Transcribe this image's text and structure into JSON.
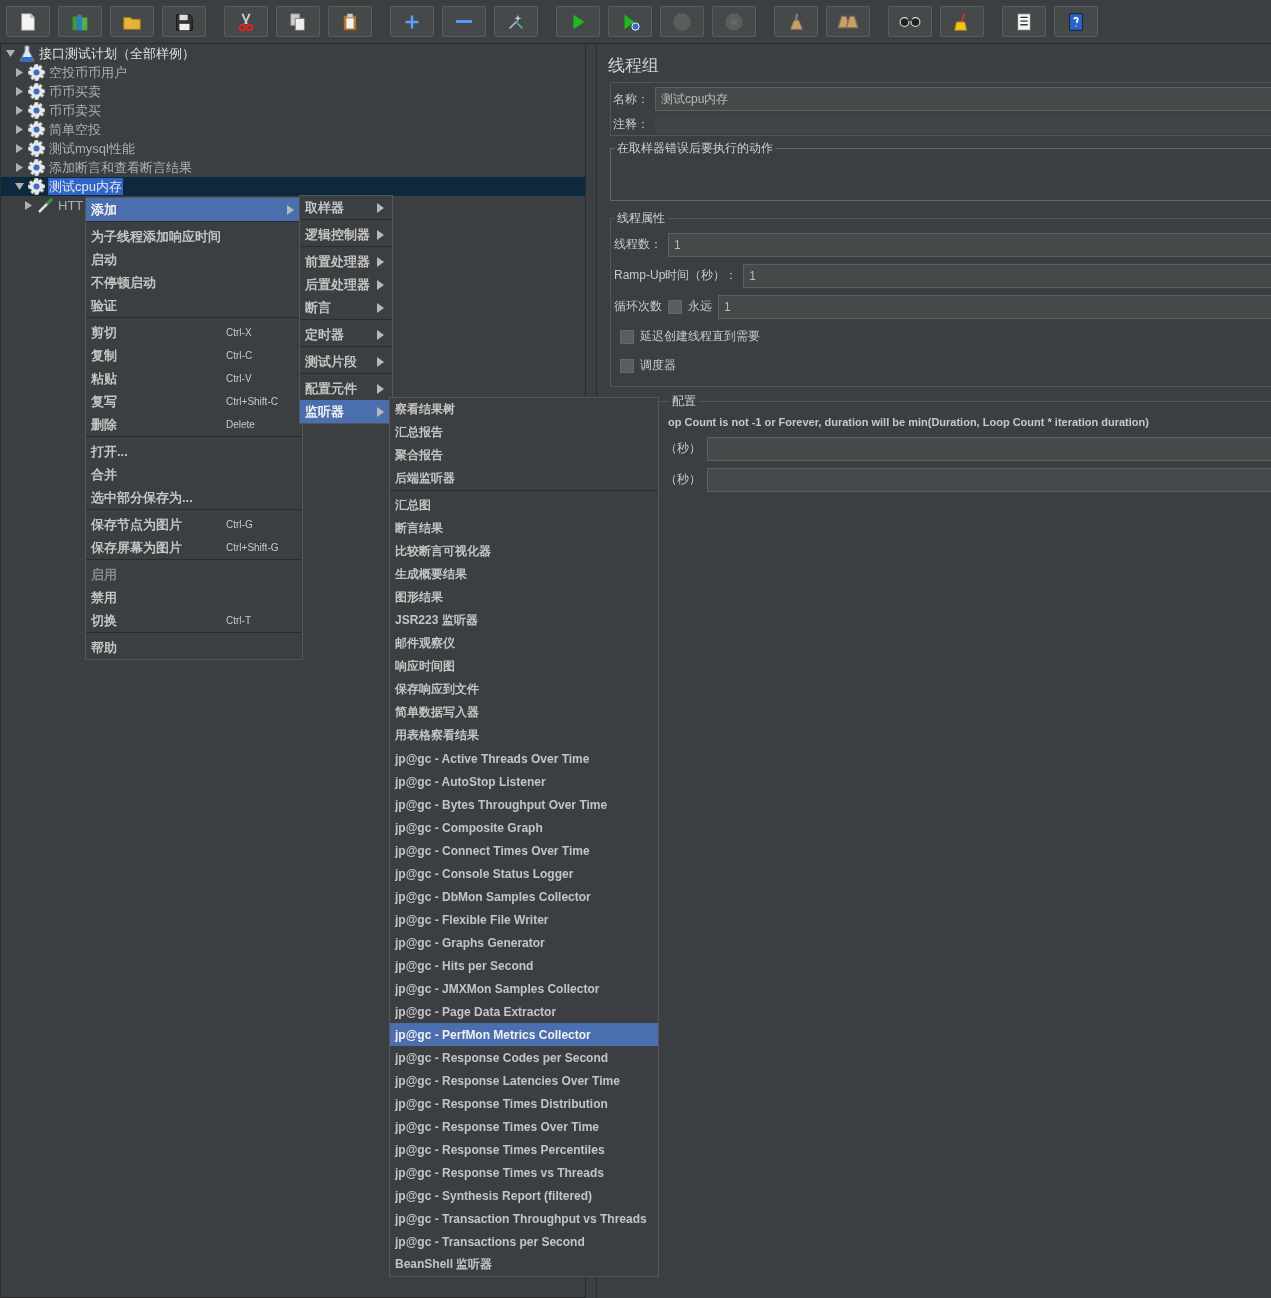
{
  "toolbar": [
    {
      "disabled": false
    },
    {
      "disabled": false
    },
    {
      "disabled": false
    },
    {
      "disabled": false
    },
    {
      "disabled": false
    },
    {
      "disabled": false
    },
    {
      "disabled": false
    },
    {
      "disabled": false
    },
    {
      "disabled": false
    },
    {
      "disabled": false
    },
    {
      "disabled": false
    },
    {
      "disabled": false
    },
    {
      "disabled": true
    },
    {
      "disabled": true
    },
    {
      "disabled": false
    },
    {
      "disabled": false
    },
    {
      "disabled": false
    },
    {
      "disabled": false
    },
    {
      "disabled": false
    },
    {
      "disabled": false
    }
  ],
  "tree": {
    "label": "接口测试计划（全部样例）",
    "kind": "plan",
    "expanded": true,
    "selected": false,
    "children": [
      {
        "label": "空投币币用户",
        "kind": "thread_group",
        "expanded": false,
        "selected": false
      },
      {
        "label": "币币买卖",
        "kind": "thread_group",
        "expanded": false,
        "selected": false
      },
      {
        "label": "币币卖买",
        "kind": "thread_group",
        "expanded": false,
        "selected": false
      },
      {
        "label": "简单空投",
        "kind": "thread_group",
        "expanded": false,
        "selected": false
      },
      {
        "label": "测试mysql性能",
        "kind": "thread_group",
        "expanded": false,
        "selected": false
      },
      {
        "label": "添加断言和查看断言结果",
        "kind": "thread_group",
        "expanded": false,
        "selected": false
      },
      {
        "label": "测试cpu内存",
        "kind": "thread_group",
        "expanded": true,
        "selected": true,
        "children": [
          {
            "label": "HTT",
            "kind": "sampler",
            "expanded": false,
            "selected": false
          }
        ]
      }
    ]
  },
  "context_menu": [
    {
      "kind": "item",
      "label": "添加",
      "submenu": true,
      "selected": true,
      "disabled": false
    },
    {
      "kind": "separator"
    },
    {
      "kind": "item",
      "label": "为子线程添加响应时间",
      "submenu": false,
      "selected": false,
      "disabled": false
    },
    {
      "kind": "item",
      "label": "启动",
      "submenu": false,
      "selected": false,
      "disabled": false
    },
    {
      "kind": "item",
      "label": "不停顿启动",
      "submenu": false,
      "selected": false,
      "disabled": false
    },
    {
      "kind": "item",
      "label": "验证",
      "submenu": false,
      "selected": false,
      "disabled": false
    },
    {
      "kind": "separator"
    },
    {
      "kind": "item",
      "label": "剪切",
      "shortcut": "Ctrl-X",
      "submenu": false,
      "selected": false,
      "disabled": false
    },
    {
      "kind": "item",
      "label": "复制",
      "shortcut": "Ctrl-C",
      "submenu": false,
      "selected": false,
      "disabled": false
    },
    {
      "kind": "item",
      "label": "粘贴",
      "shortcut": "Ctrl-V",
      "submenu": false,
      "selected": false,
      "disabled": false
    },
    {
      "kind": "item",
      "label": "复写",
      "shortcut": "Ctrl+Shift-C",
      "submenu": false,
      "selected": false,
      "disabled": false
    },
    {
      "kind": "item",
      "label": "删除",
      "shortcut": "Delete",
      "submenu": false,
      "selected": false,
      "disabled": false
    },
    {
      "kind": "separator"
    },
    {
      "kind": "item",
      "label": "打开...",
      "submenu": false,
      "selected": false,
      "disabled": false
    },
    {
      "kind": "item",
      "label": "合并",
      "submenu": false,
      "selected": false,
      "disabled": false
    },
    {
      "kind": "item",
      "label": "选中部分保存为...",
      "submenu": false,
      "selected": false,
      "disabled": false
    },
    {
      "kind": "separator"
    },
    {
      "kind": "item",
      "label": "保存节点为图片",
      "shortcut": "Ctrl-G",
      "submenu": false,
      "selected": false,
      "disabled": false
    },
    {
      "kind": "item",
      "label": "保存屏幕为图片",
      "shortcut": "Ctrl+Shift-G",
      "submenu": false,
      "selected": false,
      "disabled": false
    },
    {
      "kind": "separator"
    },
    {
      "kind": "item",
      "label": "启用",
      "submenu": false,
      "selected": false,
      "disabled": true
    },
    {
      "kind": "item",
      "label": "禁用",
      "submenu": false,
      "selected": false,
      "disabled": false
    },
    {
      "kind": "item",
      "label": "切换",
      "shortcut": "Ctrl-T",
      "submenu": false,
      "selected": false,
      "disabled": false
    },
    {
      "kind": "separator"
    },
    {
      "kind": "item",
      "label": "帮助",
      "submenu": false,
      "selected": false,
      "disabled": false
    }
  ],
  "add_submenu": [
    {
      "kind": "item",
      "label": "取样器",
      "submenu": true,
      "selected": false
    },
    {
      "kind": "separator"
    },
    {
      "kind": "item",
      "label": "逻辑控制器",
      "submenu": true,
      "selected": false
    },
    {
      "kind": "separator"
    },
    {
      "kind": "item",
      "label": "前置处理器",
      "submenu": true,
      "selected": false
    },
    {
      "kind": "item",
      "label": "后置处理器",
      "submenu": true,
      "selected": false
    },
    {
      "kind": "item",
      "label": "断言",
      "submenu": true,
      "selected": false
    },
    {
      "kind": "separator"
    },
    {
      "kind": "item",
      "label": "定时器",
      "submenu": true,
      "selected": false
    },
    {
      "kind": "separator"
    },
    {
      "kind": "item",
      "label": "测试片段",
      "submenu": true,
      "selected": false
    },
    {
      "kind": "separator"
    },
    {
      "kind": "item",
      "label": "配置元件",
      "submenu": true,
      "selected": false
    },
    {
      "kind": "item",
      "label": "监听器",
      "submenu": true,
      "selected": true
    }
  ],
  "listener_submenu": [
    {
      "kind": "item",
      "label": "察看结果树",
      "selected": false
    },
    {
      "kind": "item",
      "label": "汇总报告",
      "selected": false
    },
    {
      "kind": "item",
      "label": "聚合报告",
      "selected": false
    },
    {
      "kind": "item",
      "label": "后端监听器",
      "selected": false
    },
    {
      "kind": "separator"
    },
    {
      "kind": "item",
      "label": "汇总图",
      "selected": false
    },
    {
      "kind": "item",
      "label": "断言结果",
      "selected": false
    },
    {
      "kind": "item",
      "label": "比较断言可视化器",
      "selected": false
    },
    {
      "kind": "item",
      "label": "生成概要结果",
      "selected": false
    },
    {
      "kind": "item",
      "label": "图形结果",
      "selected": false
    },
    {
      "kind": "item",
      "label": "JSR223 监听器",
      "selected": false
    },
    {
      "kind": "item",
      "label": "邮件观察仪",
      "selected": false
    },
    {
      "kind": "item",
      "label": "响应时间图",
      "selected": false
    },
    {
      "kind": "item",
      "label": "保存响应到文件",
      "selected": false
    },
    {
      "kind": "item",
      "label": "简单数据写入器",
      "selected": false
    },
    {
      "kind": "item",
      "label": "用表格察看结果",
      "selected": false
    },
    {
      "kind": "item",
      "label": "jp@gc - Active Threads Over Time",
      "selected": false
    },
    {
      "kind": "item",
      "label": "jp@gc - AutoStop Listener",
      "selected": false
    },
    {
      "kind": "item",
      "label": "jp@gc - Bytes Throughput Over Time",
      "selected": false
    },
    {
      "kind": "item",
      "label": "jp@gc - Composite Graph",
      "selected": false
    },
    {
      "kind": "item",
      "label": "jp@gc - Connect Times Over Time",
      "selected": false
    },
    {
      "kind": "item",
      "label": "jp@gc - Console Status Logger",
      "selected": false
    },
    {
      "kind": "item",
      "label": "jp@gc - DbMon Samples Collector",
      "selected": false
    },
    {
      "kind": "item",
      "label": "jp@gc - Flexible File Writer",
      "selected": false
    },
    {
      "kind": "item",
      "label": "jp@gc - Graphs Generator",
      "selected": false
    },
    {
      "kind": "item",
      "label": "jp@gc - Hits per Second",
      "selected": false
    },
    {
      "kind": "item",
      "label": "jp@gc - JMXMon Samples Collector",
      "selected": false
    },
    {
      "kind": "item",
      "label": "jp@gc - Page Data Extractor",
      "selected": false
    },
    {
      "kind": "item",
      "label": "jp@gc - PerfMon Metrics Collector",
      "selected": true
    },
    {
      "kind": "item",
      "label": "jp@gc - Response Codes per Second",
      "selected": false
    },
    {
      "kind": "item",
      "label": "jp@gc - Response Latencies Over Time",
      "selected": false
    },
    {
      "kind": "item",
      "label": "jp@gc - Response Times Distribution",
      "selected": false
    },
    {
      "kind": "item",
      "label": "jp@gc - Response Times Over Time",
      "selected": false
    },
    {
      "kind": "item",
      "label": "jp@gc - Response Times Percentiles",
      "selected": false
    },
    {
      "kind": "item",
      "label": "jp@gc - Response Times vs Threads",
      "selected": false
    },
    {
      "kind": "item",
      "label": "jp@gc - Synthesis Report (filtered)",
      "selected": false
    },
    {
      "kind": "item",
      "label": "jp@gc - Transaction Throughput vs Threads",
      "selected": false
    },
    {
      "kind": "item",
      "label": "jp@gc - Transactions per Second",
      "selected": false
    },
    {
      "kind": "item",
      "label": "BeanShell 监听器",
      "selected": false
    }
  ],
  "panel": {
    "title": "线程组",
    "name_label": "名称：",
    "name_value": "测试cpu内存",
    "comment_label": "注释：",
    "error_action_legend": "在取样器错误后要执行的动作",
    "thread_properties": {
      "legend": "线程属性",
      "threads_label": "线程数：",
      "threads_value": "1",
      "rampup_label": "Ramp-Up时间（秒）：",
      "rampup_value": "1",
      "loop_label": "循环次数",
      "forever_label": "永远",
      "forever_checked": false,
      "loop_value": "1",
      "delay_label": "延迟创建线程直到需要",
      "delay_checked": false,
      "scheduler_label": "调度器",
      "scheduler_checked": false
    },
    "scheduler_config": {
      "legend": "配置",
      "note": "op Count is not -1 or Forever, duration will be min(Duration, Loop Count * iteration duration)",
      "duration_label": "（秒）",
      "startup_delay_label": "（秒）"
    }
  }
}
